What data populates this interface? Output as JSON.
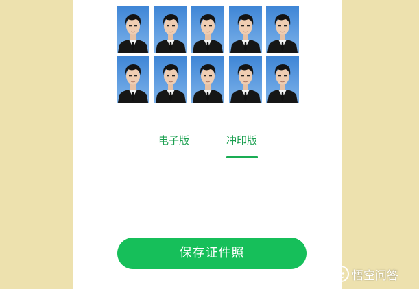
{
  "photo_sheet": {
    "rows": 2,
    "columns": 5,
    "background_color": "#5b9be3"
  },
  "tabs": [
    {
      "label": "电子版",
      "active": false
    },
    {
      "label": "冲印版",
      "active": true
    }
  ],
  "accent_color": "#1aad54",
  "save_button": {
    "label": "保存证件照"
  },
  "watermark": {
    "label": "悟空问答",
    "icon": "wukong-logo-icon"
  }
}
